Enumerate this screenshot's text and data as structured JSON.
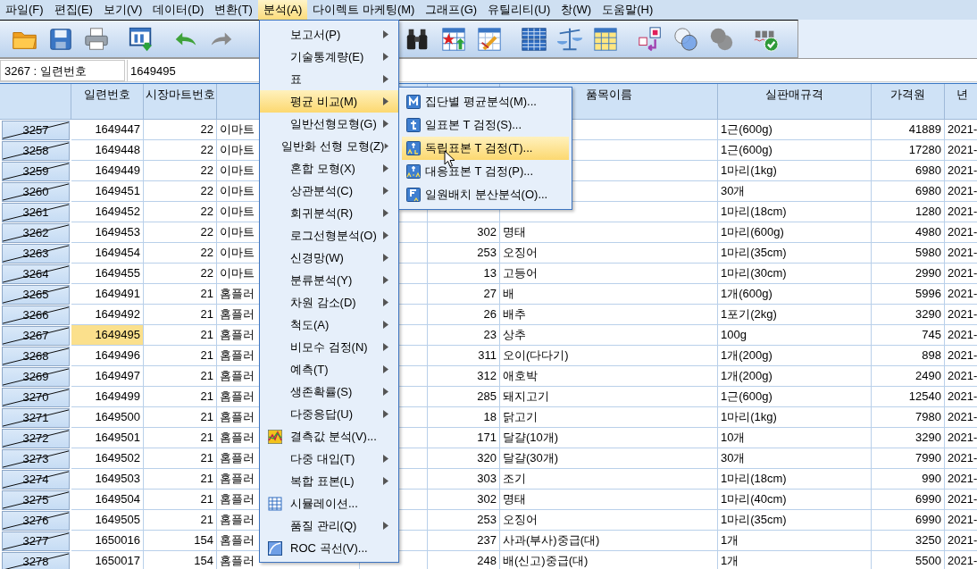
{
  "menu_bar": [
    {
      "label": "파일(F)",
      "selected": false
    },
    {
      "label": "편집(E)",
      "selected": false
    },
    {
      "label": "보기(V)",
      "selected": false
    },
    {
      "label": "데이터(D)",
      "selected": false
    },
    {
      "label": "변환(T)",
      "selected": false
    },
    {
      "label": "분석(A)",
      "selected": true
    },
    {
      "label": "다이렉트 마케팅(M)",
      "selected": false
    },
    {
      "label": "그래프(G)",
      "selected": false
    },
    {
      "label": "유틸리티(U)",
      "selected": false
    },
    {
      "label": "창(W)",
      "selected": false
    },
    {
      "label": "도움말(H)",
      "selected": false
    }
  ],
  "cell_editor": {
    "cell": "3267 : 일련번호",
    "value": "1649495"
  },
  "table": {
    "columns": [
      "일련번호",
      "시장마트번호",
      "품목이름",
      "실판매규격",
      "가격원",
      "년"
    ],
    "rows": [
      {
        "number": "3257",
        "crossed_out": true,
        "selected": false,
        "serial": "1649447",
        "mart_no": "22",
        "store": "이마트",
        "spec": "1근(600g)",
        "price": "41889",
        "year": "2021-"
      },
      {
        "number": "3258",
        "crossed_out": true,
        "selected": false,
        "serial": "1649448",
        "mart_no": "22",
        "store": "이마트",
        "spec": "1근(600g)",
        "price": "17280",
        "year": "2021-"
      },
      {
        "number": "3259",
        "crossed_out": true,
        "selected": false,
        "serial": "1649449",
        "mart_no": "22",
        "store": "이마트",
        "spec": "1마리(1kg)",
        "price": "6980",
        "year": "2021-"
      },
      {
        "number": "3260",
        "crossed_out": true,
        "selected": false,
        "serial": "1649451",
        "mart_no": "22",
        "store": "이마트",
        "spec": "30개",
        "price": "6980",
        "year": "2021-"
      },
      {
        "number": "3261",
        "crossed_out": true,
        "selected": false,
        "serial": "1649452",
        "mart_no": "22",
        "store": "이마트",
        "spec": "1마리(18cm)",
        "price": "1280",
        "year": "2021-"
      },
      {
        "number": "3262",
        "crossed_out": true,
        "selected": false,
        "serial": "1649453",
        "mart_no": "22",
        "store": "이마트",
        "code": "302",
        "item": "명태",
        "spec": "1마리(600g)",
        "price": "4980",
        "year": "2021-"
      },
      {
        "number": "3263",
        "crossed_out": true,
        "selected": false,
        "serial": "1649454",
        "mart_no": "22",
        "store": "이마트",
        "code": "253",
        "item": "오징어",
        "spec": "1마리(35cm)",
        "price": "5980",
        "year": "2021-"
      },
      {
        "number": "3264",
        "crossed_out": true,
        "selected": false,
        "serial": "1649455",
        "mart_no": "22",
        "store": "이마트",
        "code": "13",
        "item": "고등어",
        "spec": "1마리(30cm)",
        "price": "2990",
        "year": "2021-"
      },
      {
        "number": "3265",
        "crossed_out": true,
        "selected": false,
        "serial": "1649491",
        "mart_no": "21",
        "store": "홈플러",
        "code": "27",
        "item": "배",
        "spec": "1개(600g)",
        "price": "5996",
        "year": "2021-"
      },
      {
        "number": "3266",
        "crossed_out": true,
        "selected": false,
        "serial": "1649492",
        "mart_no": "21",
        "store": "홈플러",
        "code": "26",
        "item": "배추",
        "spec": "1포기(2kg)",
        "price": "3290",
        "year": "2021-"
      },
      {
        "number": "3267",
        "crossed_out": true,
        "selected": true,
        "serial": "1649495",
        "mart_no": "21",
        "store": "홈플러",
        "code": "23",
        "item": "상추",
        "spec": "100g",
        "price": "745",
        "year": "2021-"
      },
      {
        "number": "3268",
        "crossed_out": true,
        "selected": false,
        "serial": "1649496",
        "mart_no": "21",
        "store": "홈플러",
        "code": "311",
        "item": "오이(다다기)",
        "spec": "1개(200g)",
        "price": "898",
        "year": "2021-"
      },
      {
        "number": "3269",
        "crossed_out": true,
        "selected": false,
        "serial": "1649497",
        "mart_no": "21",
        "store": "홈플러",
        "code": "312",
        "item": "애호박",
        "spec": "1개(200g)",
        "price": "2490",
        "year": "2021-"
      },
      {
        "number": "3270",
        "crossed_out": true,
        "selected": false,
        "serial": "1649499",
        "mart_no": "21",
        "store": "홈플러",
        "code": "285",
        "item": "돼지고기",
        "spec": "1근(600g)",
        "price": "12540",
        "year": "2021-"
      },
      {
        "number": "3271",
        "crossed_out": true,
        "selected": false,
        "serial": "1649500",
        "mart_no": "21",
        "store": "홈플러",
        "code": "18",
        "item": "닭고기",
        "spec": "1마리(1kg)",
        "price": "7980",
        "year": "2021-"
      },
      {
        "number": "3272",
        "crossed_out": true,
        "selected": false,
        "serial": "1649501",
        "mart_no": "21",
        "store": "홈플러",
        "code": "171",
        "item": "달걀(10개)",
        "spec": "10개",
        "price": "3290",
        "year": "2021-"
      },
      {
        "number": "3273",
        "crossed_out": true,
        "selected": false,
        "serial": "1649502",
        "mart_no": "21",
        "store": "홈플러",
        "code": "320",
        "item": "달걀(30개)",
        "spec": "30개",
        "price": "7990",
        "year": "2021-"
      },
      {
        "number": "3274",
        "crossed_out": true,
        "selected": false,
        "serial": "1649503",
        "mart_no": "21",
        "store": "홈플러",
        "code": "303",
        "item": "조기",
        "spec": "1마리(18cm)",
        "price": "990",
        "year": "2021-"
      },
      {
        "number": "3275",
        "crossed_out": true,
        "selected": false,
        "serial": "1649504",
        "mart_no": "21",
        "store": "홈플러",
        "code": "302",
        "item": "명태",
        "spec": "1마리(40cm)",
        "price": "6990",
        "year": "2021-"
      },
      {
        "number": "3276",
        "crossed_out": true,
        "selected": false,
        "serial": "1649505",
        "mart_no": "21",
        "store": "홈플러",
        "code": "253",
        "item": "오징어",
        "spec": "1마리(35cm)",
        "price": "6990",
        "year": "2021-"
      },
      {
        "number": "3277",
        "crossed_out": true,
        "selected": false,
        "serial": "1650016",
        "mart_no": "154",
        "store": "홈플러",
        "code": "237",
        "item": "사과(부사)중급(대)",
        "spec": "1개",
        "price": "3250",
        "year": "2021-"
      },
      {
        "number": "3278",
        "crossed_out": true,
        "selected": false,
        "serial": "1650017",
        "mart_no": "154",
        "store": "홈플러",
        "code": "248",
        "item": "배(신고)중급(대)",
        "spec": "1개",
        "price": "5500",
        "year": "2021-"
      }
    ]
  },
  "analyze_menu": {
    "items": [
      {
        "label": "보고서(P)",
        "kind": "submenu",
        "selected": false
      },
      {
        "label": "기술통계량(E)",
        "kind": "submenu",
        "selected": false
      },
      {
        "label": "표",
        "kind": "submenu",
        "selected": false
      },
      {
        "label": "평균 비교(M)",
        "kind": "submenu",
        "selected": true
      },
      {
        "label": "일반선형모형(G)",
        "kind": "submenu",
        "selected": false
      },
      {
        "label": "일반화 선형 모형(Z)",
        "kind": "submenu",
        "selected": false
      },
      {
        "label": "혼합 모형(X)",
        "kind": "submenu",
        "selected": false
      },
      {
        "label": "상관분석(C)",
        "kind": "submenu",
        "selected": false
      },
      {
        "label": "회귀분석(R)",
        "kind": "submenu",
        "selected": false
      },
      {
        "label": "로그선형분석(O)",
        "kind": "submenu",
        "selected": false
      },
      {
        "label": "신경망(W)",
        "kind": "submenu",
        "selected": false
      },
      {
        "label": "분류분석(Y)",
        "kind": "submenu",
        "selected": false
      },
      {
        "label": "차원 감소(D)",
        "kind": "submenu",
        "selected": false
      },
      {
        "label": "척도(A)",
        "kind": "submenu",
        "selected": false
      },
      {
        "label": "비모수 검정(N)",
        "kind": "submenu",
        "selected": false
      },
      {
        "label": "예측(T)",
        "kind": "submenu",
        "selected": false
      },
      {
        "label": "생존확률(S)",
        "kind": "submenu",
        "selected": false
      },
      {
        "label": "다중응답(U)",
        "kind": "submenu",
        "selected": false
      },
      {
        "label": "결측값 분석(V)...",
        "kind": "command",
        "selected": false
      },
      {
        "label": "다중 대입(T)",
        "kind": "submenu",
        "selected": false
      },
      {
        "label": "복합 표본(L)",
        "kind": "submenu",
        "selected": false
      },
      {
        "label": "시뮬레이션...",
        "kind": "command",
        "selected": false
      },
      {
        "label": "품질 관리(Q)",
        "kind": "submenu",
        "selected": false
      },
      {
        "label": "ROC 곡선(V)...",
        "kind": "command",
        "selected": false
      }
    ]
  },
  "compare_means_menu": {
    "items": [
      {
        "label": "집단별 평균분석(M)...",
        "selected": false
      },
      {
        "label": "일표본 T 검정(S)...",
        "selected": false
      },
      {
        "label": "독립표본 T 검정(T)...",
        "selected": true
      },
      {
        "label": "대응표본 T 검정(P)...",
        "selected": false
      },
      {
        "label": "일원배치 분산분석(O)...",
        "selected": false
      }
    ]
  }
}
